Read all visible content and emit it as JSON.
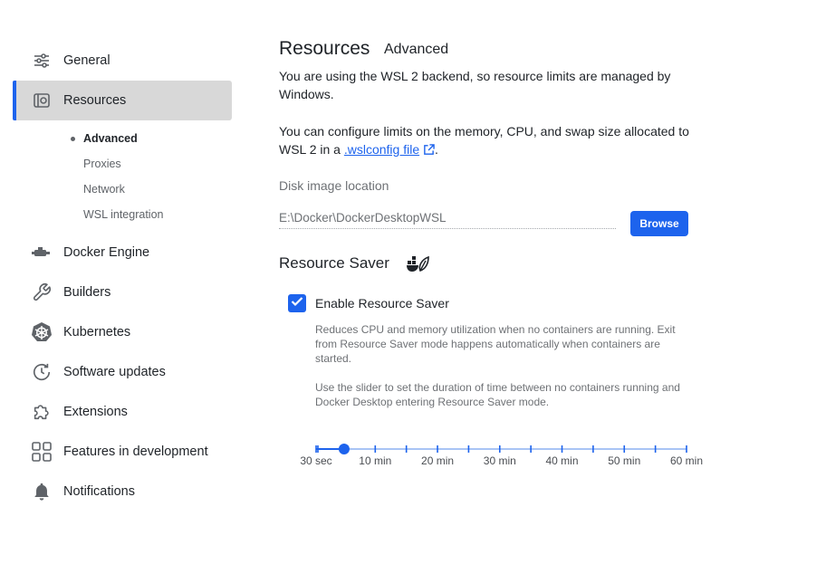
{
  "sidebar": {
    "items": [
      {
        "label": "General",
        "icon": "sliders-icon"
      },
      {
        "label": "Resources",
        "icon": "resources-icon"
      },
      {
        "label": "Docker Engine",
        "icon": "whale-engine-icon"
      },
      {
        "label": "Builders",
        "icon": "wrench-icon"
      },
      {
        "label": "Kubernetes",
        "icon": "helm-wheel-icon"
      },
      {
        "label": "Software updates",
        "icon": "clock-update-icon"
      },
      {
        "label": "Extensions",
        "icon": "puzzle-icon"
      },
      {
        "label": "Features in development",
        "icon": "grid-icon"
      },
      {
        "label": "Notifications",
        "icon": "bell-icon"
      }
    ],
    "resources_sub": [
      "Advanced",
      "Proxies",
      "Network",
      "WSL integration"
    ]
  },
  "main": {
    "title": "Resources",
    "tab": "Advanced",
    "para1": "You are using the WSL 2 backend, so resource limits are managed by Windows.",
    "para2_prefix": "You can configure limits on the memory, CPU, and swap size allocated to WSL 2 in a ",
    "para2_link": ".wslconfig file",
    "para2_suffix": ".",
    "disk_label": "Disk image location",
    "disk_path": "E:\\Docker\\DockerDesktopWSL",
    "browse_label": "Browse",
    "saver_title": "Resource Saver",
    "saver_checkbox_label": "Enable Resource Saver",
    "saver_checked": true,
    "saver_desc1": "Reduces CPU and memory utilization when no containers are running. Exit from Resource Saver mode happens automatically when containers are started.",
    "saver_desc2": "Use the slider to set the duration of time between no containers running and Docker Desktop entering Resource Saver mode.",
    "slider_labels": [
      "30 sec",
      "10 min",
      "20 min",
      "30 min",
      "40 min",
      "50 min",
      "60 min"
    ],
    "slider_value_minutes": 5
  },
  "colors": {
    "accent": "#1d63ed",
    "active_bg": "#d8d8d8"
  }
}
